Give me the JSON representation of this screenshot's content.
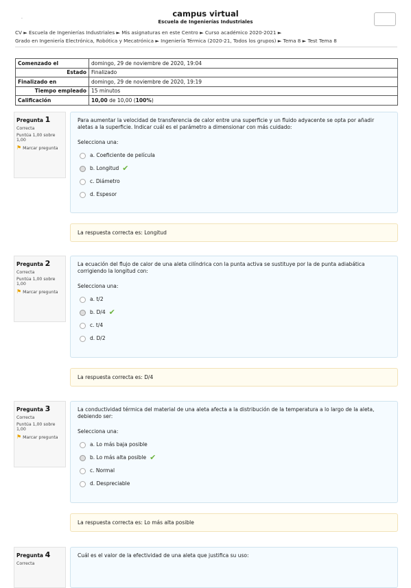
{
  "header": {
    "dot": ".",
    "title": "campus virtual",
    "subtitle": "Escuela de Ingenierías Industriales",
    "breadcrumb_line1": "CV ► Escuela de Ingenierías Industriales ► Mis asignaturas en este Centro ► Curso académico 2020-2021 ►",
    "breadcrumb_line2": "Grado en Ingeniería Electrónica, Robótica y Mecatrónica ► Ingeniería Térmica (2020-21, Todos los grupos) ► Tema 8 ► Test Tema 8"
  },
  "summary": {
    "started_label": "Comenzado el",
    "started_value": "domingo, 29 de noviembre de 2020, 19:04",
    "state_label": "Estado",
    "state_value": "Finalizado",
    "finished_label": "Finalizado en",
    "finished_value": "domingo, 29 de noviembre de 2020, 19:19",
    "time_label": "Tiempo empleado",
    "time_value": "15 minutos",
    "grade_label": "Calificación",
    "grade_score": "10,00",
    "grade_mid": " de 10,00 (",
    "grade_pct": "100%",
    "grade_end": ")"
  },
  "info_common": {
    "status": "Correcta",
    "points": "Puntúa 1,00 sobre 1,00",
    "flag_label": "Marcar pregunta",
    "select_one": "Selecciona una:",
    "word": "Pregunta"
  },
  "questions": [
    {
      "number": "1",
      "text": "Para aumentar la velocidad de transferencia de calor entre una superficie y un fluido adyacente se opta por añadir aletas a la superficie. Indicar cuál es el parámetro a dimensionar con más cuidado:",
      "options": [
        "a. Coeficiente de película",
        "b. Longitud",
        "c. Diámetro",
        "d. Espesor"
      ],
      "feedback": "La respuesta correcta es: Longitud"
    },
    {
      "number": "2",
      "text": "La ecuación del flujo de calor de una aleta cilíndrica con la punta activa se sustituye por la de punta adiabática corrigiendo la longitud con:",
      "options": [
        "a. t/2",
        "b. D/4",
        "c. t/4",
        "d. D/2"
      ],
      "feedback": "La respuesta correcta es: D/4"
    },
    {
      "number": "3",
      "text": "La conductividad térmica del material de una aleta afecta a la distribución de la temperatura a lo largo de la aleta, debiendo ser:",
      "options": [
        "a. Lo más baja posible",
        "b. Lo más alta posible",
        "c. Normal",
        "d. Despreciable"
      ],
      "feedback": "La respuesta correcta es: Lo más alta posible"
    },
    {
      "number": "4",
      "text": "Cuál es el valor de la efectividad de una aleta que justifica su uso:"
    }
  ],
  "icons": {
    "check": "checkmark-icon",
    "flag": "flag-icon"
  },
  "colors": {
    "check": "#6cb33f",
    "flag": "#e8a200",
    "question_bg": "#f5fbff",
    "feedback_bg": "#fffcf0"
  }
}
